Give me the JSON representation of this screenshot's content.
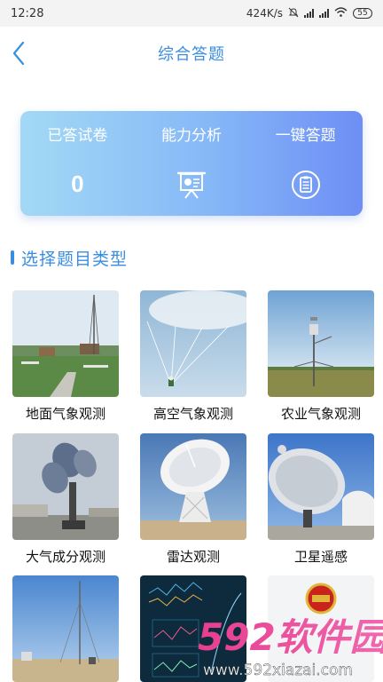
{
  "status_bar": {
    "time": "12:28",
    "speed": "424K/s",
    "battery": "55"
  },
  "nav": {
    "title": "综合答题"
  },
  "stats": {
    "answered_label": "已答试卷",
    "answered_value": "0",
    "analysis_label": "能力分析",
    "quick_label": "一键答题"
  },
  "section": {
    "title": "选择题目类型"
  },
  "categories": [
    {
      "label": "地面气象观测"
    },
    {
      "label": "高空气象观测"
    },
    {
      "label": "农业气象观测"
    },
    {
      "label": "大气成分观测"
    },
    {
      "label": "雷达观测"
    },
    {
      "label": "卫星遥感"
    }
  ],
  "watermark": {
    "brand": "592软件园",
    "url": "www.592xiazai.com"
  },
  "colors": {
    "accent": "#3a8ee0",
    "card_start": "#a3d9f5",
    "card_end": "#6d8ef5"
  }
}
